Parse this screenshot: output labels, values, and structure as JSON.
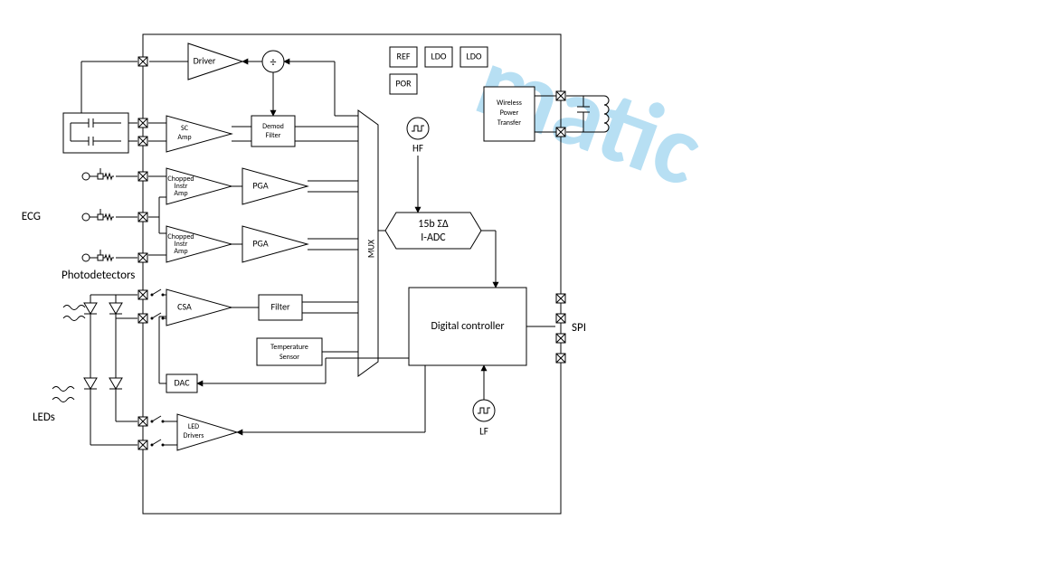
{
  "watermark_fragment": "matic",
  "external_labels": {
    "ecg": "ECG",
    "photodetectors": "Photodetectors",
    "leds": "LEDs",
    "spi": "SPI"
  },
  "blocks": {
    "driver": "Driver",
    "sc_amp_l1": "SC",
    "sc_amp_l2": "Amp",
    "demod_l1": "Demod",
    "demod_l2": "Filter",
    "chopped_l1": "Chopped",
    "chopped_l2": "Instr",
    "chopped_l3": "Amp",
    "pga": "PGA",
    "csa": "CSA",
    "filter": "Filter",
    "temp_l1": "Temperature",
    "temp_l2": "Sensor",
    "dac": "DAC",
    "led_drv_l1": "LED",
    "led_drv_l2": "Drivers",
    "mux": "MUX",
    "adc_l1": "15b ΣΔ",
    "adc_l2": "I-ADC",
    "digital": "Digital controller",
    "ref": "REF",
    "ldo": "LDO",
    "por": "POR",
    "wpt_l1": "Wireless",
    "wpt_l2": "Power",
    "wpt_l3": "Transfer",
    "hf": "HF",
    "lf": "LF"
  },
  "symbols": {
    "divide": "÷",
    "clock": "Ш"
  }
}
